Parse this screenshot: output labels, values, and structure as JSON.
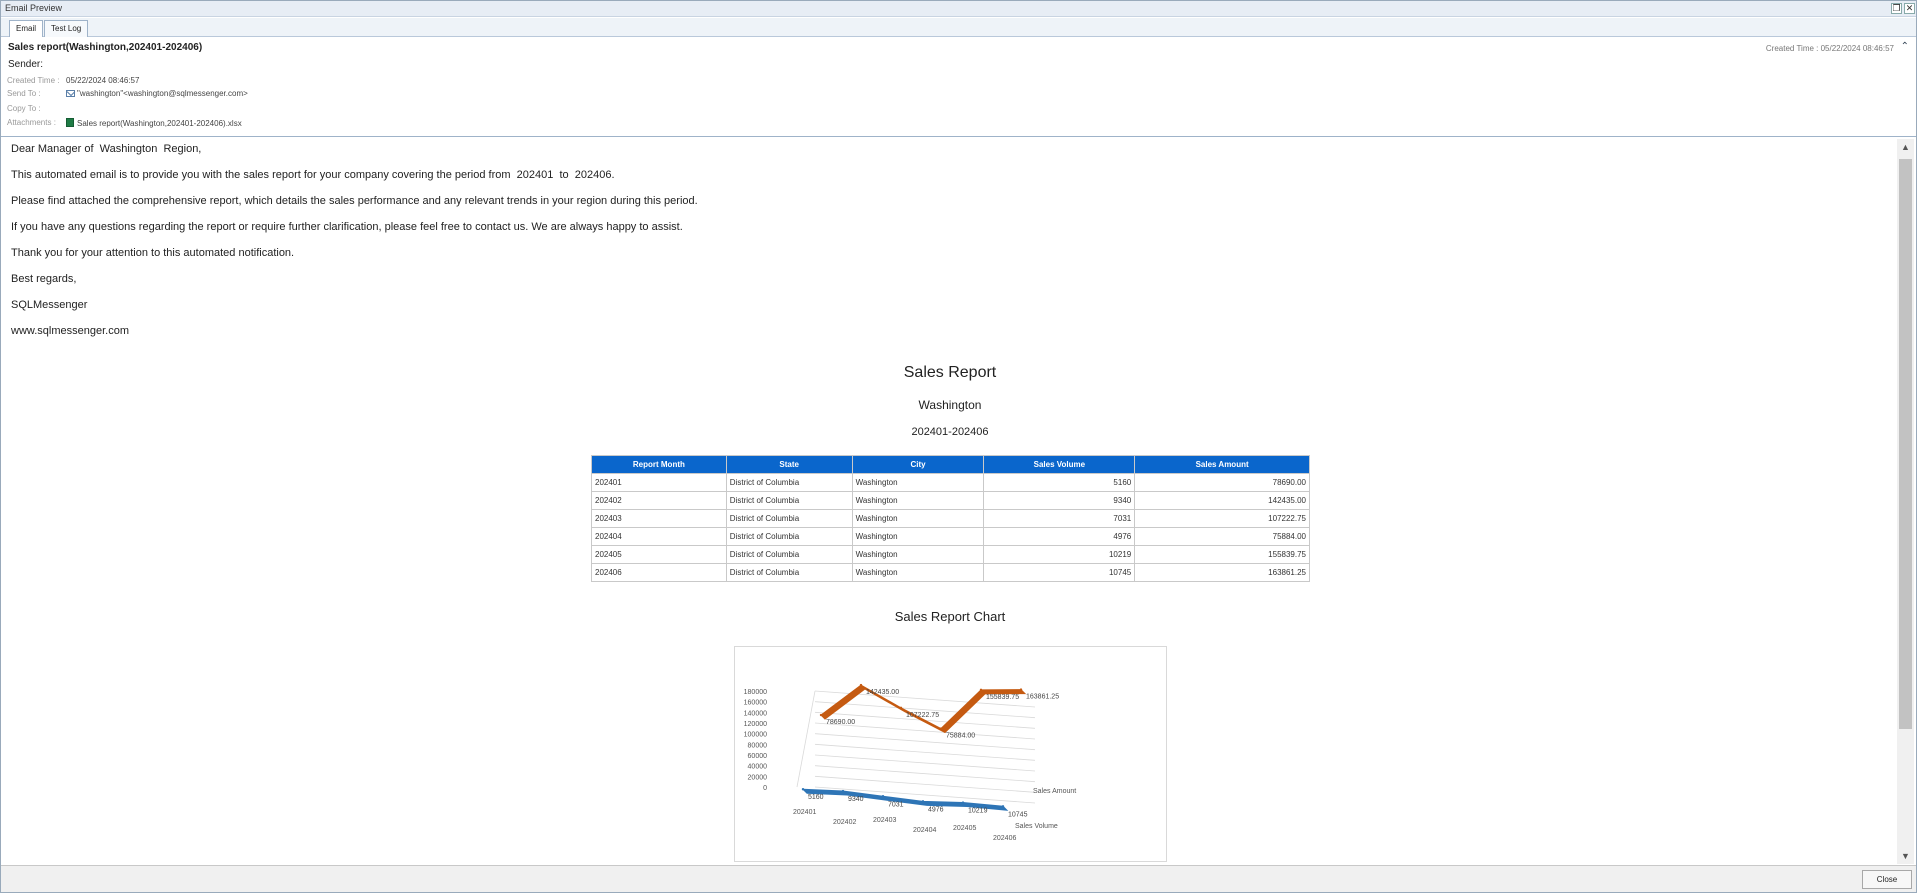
{
  "window": {
    "title": "Email Preview",
    "restore_glyph": "❐",
    "close_glyph": "✕"
  },
  "tabs": [
    {
      "label": "Email"
    },
    {
      "label": "Test Log"
    }
  ],
  "header": {
    "subject": "Sales report(Washington,202401-202406)",
    "created_right": "Created Time : 05/22/2024 08:46:57",
    "collapse_glyph": "⌃",
    "sender_label": "Sender:",
    "created_label": "Created Time :",
    "created_value": "05/22/2024 08:46:57",
    "send_to_label": "Send To :",
    "send_to_value": "\"washington\"<washington@sqlmessenger.com>",
    "copy_to_label": "Copy To :",
    "attachments_label": "Attachments :",
    "attachment_value": "Sales report(Washington,202401-202406).xlsx"
  },
  "body": {
    "paragraphs": [
      "Dear Manager of  Washington  Region,",
      "This automated email is to provide you with the sales report for your company covering the period from  202401  to  202406.",
      "Please find attached the comprehensive report, which details the sales performance and any relevant trends in your region during this period.",
      "If you have any questions regarding the report or require further clarification, please feel free to contact us. We are always happy to assist.",
      "Thank you for your attention to this automated notification.",
      "Best regards,",
      "SQLMessenger",
      "www.sqlmessenger.com"
    ],
    "report_title": "Sales Report",
    "report_region": "Washington",
    "report_period": "202401-202406",
    "chart_heading": "Sales Report Chart"
  },
  "table": {
    "headers": [
      "Report Month",
      "State",
      "City",
      "Sales Volume",
      "Sales Amount"
    ],
    "rows": [
      [
        "202401",
        "District of Columbia",
        "Washington",
        "5160",
        "78690.00"
      ],
      [
        "202402",
        "District of Columbia",
        "Washington",
        "9340",
        "142435.00"
      ],
      [
        "202403",
        "District of Columbia",
        "Washington",
        "7031",
        "107222.75"
      ],
      [
        "202404",
        "District of Columbia",
        "Washington",
        "4976",
        "75884.00"
      ],
      [
        "202405",
        "District of Columbia",
        "Washington",
        "10219",
        "155839.75"
      ],
      [
        "202406",
        "District of Columbia",
        "Washington",
        "10745",
        "163861.25"
      ]
    ]
  },
  "chart_data": {
    "type": "line",
    "title": "",
    "categories": [
      "202401",
      "202402",
      "202403",
      "202404",
      "202405",
      "202406"
    ],
    "series": [
      {
        "name": "Sales Amount",
        "values": [
          78690.0,
          142435.0,
          107222.75,
          75884.0,
          155839.75,
          163861.25
        ],
        "labels": [
          "78690.00",
          "142435.00",
          "107222.75",
          "75884.00",
          "155839.75",
          "163861.25"
        ],
        "color": "#c55a11"
      },
      {
        "name": "Sales Volume",
        "values": [
          5160,
          9340,
          7031,
          4976,
          10219,
          10745
        ],
        "labels": [
          "5160",
          "9340",
          "7031",
          "4976",
          "10219",
          "10745"
        ],
        "color": "#2e75b6"
      }
    ],
    "yticks": [
      "0",
      "20000",
      "40000",
      "60000",
      "80000",
      "100000",
      "120000",
      "140000",
      "160000",
      "180000"
    ],
    "ylim": [
      0,
      180000
    ],
    "style": "3d",
    "grid": true
  },
  "footer": {
    "close_label": "Close"
  },
  "scroll": {
    "up_glyph": "▲",
    "down_glyph": "▼"
  }
}
